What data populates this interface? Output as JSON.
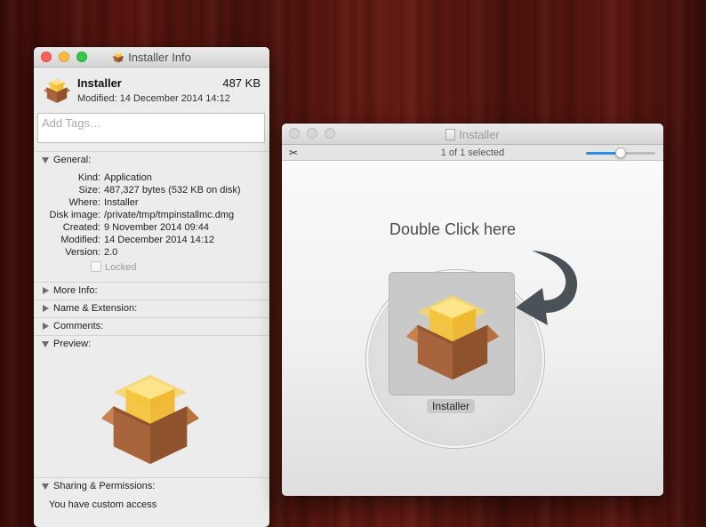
{
  "info_window": {
    "title": "Installer Info",
    "name": "Installer",
    "size": "487 KB",
    "modified": "Modified: 14 December 2014 14:12",
    "tags_placeholder": "Add Tags…",
    "sections": {
      "general": "General:",
      "more_info": "More Info:",
      "name_extension": "Name & Extension:",
      "comments": "Comments:",
      "preview": "Preview:",
      "sharing": "Sharing & Permissions:"
    },
    "general": [
      {
        "key": "Kind:",
        "value": "Application"
      },
      {
        "key": "Size:",
        "value": "487,327 bytes (532 KB on disk)"
      },
      {
        "key": "Where:",
        "value": "Installer"
      },
      {
        "key": "Disk image:",
        "value": "/private/tmp/tmpinstallmc.dmg"
      },
      {
        "key": "Created:",
        "value": "9 November 2014 09:44"
      },
      {
        "key": "Modified:",
        "value": "14 December 2014 14:12"
      },
      {
        "key": "Version:",
        "value": "2.0"
      }
    ],
    "locked_label": "Locked",
    "access_text": "You have custom access"
  },
  "installer_window": {
    "title": "Installer",
    "selection_status": "1 of 1 selected",
    "zoom_level": 0.5,
    "instruction": "Double Click here",
    "icon_label": "Installer"
  },
  "colors": {
    "accent": "#2f8de4",
    "close": "#fc605c",
    "minimize": "#fdbc40",
    "zoom": "#34c84a",
    "arrow": "#4b5257",
    "box_brown": "#a8643a",
    "box_yellow": "#f7c83a"
  },
  "icons": [
    "installer-box-icon",
    "tools-icon",
    "document-icon",
    "curved-arrow-icon"
  ]
}
